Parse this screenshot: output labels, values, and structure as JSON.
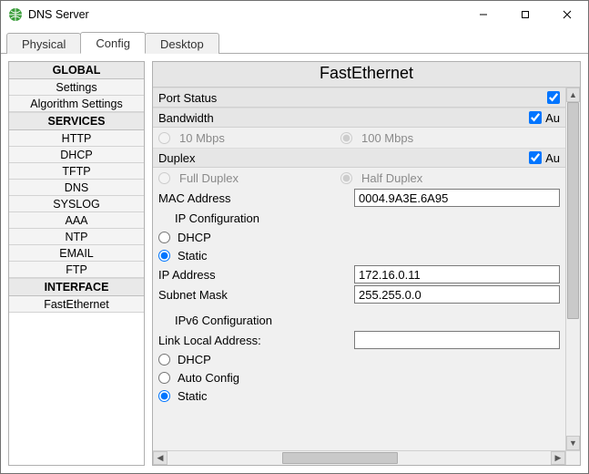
{
  "window": {
    "title": "DNS Server"
  },
  "tabs": [
    "Physical",
    "Config",
    "Desktop"
  ],
  "active_tab_index": 1,
  "sidebar": {
    "sections": [
      {
        "header": "GLOBAL",
        "items": [
          "Settings",
          "Algorithm Settings"
        ]
      },
      {
        "header": "SERVICES",
        "items": [
          "HTTP",
          "DHCP",
          "TFTP",
          "DNS",
          "SYSLOG",
          "AAA",
          "NTP",
          "EMAIL",
          "FTP"
        ]
      },
      {
        "header": "INTERFACE",
        "items": [
          "FastEthernet"
        ]
      }
    ]
  },
  "panel": {
    "title": "FastEthernet",
    "port_status": {
      "label": "Port Status",
      "checked": true
    },
    "bandwidth": {
      "label": "Bandwidth",
      "auto_checked": true,
      "auto_label_truncated": "Au",
      "opt_a": "10 Mbps",
      "opt_b": "100 Mbps",
      "disabled": true,
      "selected": "b"
    },
    "duplex": {
      "label": "Duplex",
      "auto_checked": true,
      "auto_label_truncated": "Au",
      "opt_a": "Full Duplex",
      "opt_b": "Half Duplex",
      "disabled": true,
      "selected": "b"
    },
    "mac": {
      "label": "MAC Address",
      "value": "0004.9A3E.6A95"
    },
    "ip_config": {
      "header": "IP Configuration",
      "mode_dhcp": "DHCP",
      "mode_static": "Static",
      "selected_mode": "static",
      "ip": {
        "label": "IP Address",
        "value": "172.16.0.11"
      },
      "mask": {
        "label": "Subnet Mask",
        "value": "255.255.0.0"
      }
    },
    "ipv6_config": {
      "header": "IPv6 Configuration",
      "link_local_label": "Link Local Address:",
      "link_local_value": "",
      "mode_dhcp": "DHCP",
      "mode_auto": "Auto Config",
      "mode_static": "Static",
      "selected_mode": "static"
    }
  }
}
